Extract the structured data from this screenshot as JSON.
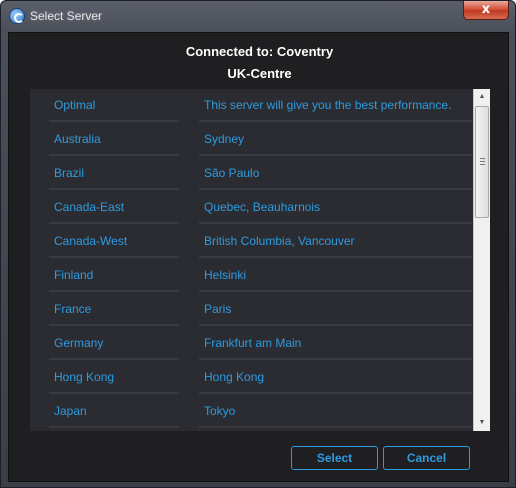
{
  "window": {
    "title": "Select Server",
    "close_label": "x"
  },
  "header": {
    "connected_label": "Connected to:",
    "connected_value": "Coventry",
    "region": "UK-Centre"
  },
  "servers": [
    {
      "region": "Optimal",
      "city": "This server will give you the best performance."
    },
    {
      "region": "Australia",
      "city": "Sydney"
    },
    {
      "region": "Brazil",
      "city": "São Paulo"
    },
    {
      "region": "Canada-East",
      "city": "Quebec, Beauharnois"
    },
    {
      "region": "Canada-West",
      "city": "British Columbia, Vancouver"
    },
    {
      "region": "Finland",
      "city": "Helsinki"
    },
    {
      "region": "France",
      "city": "Paris"
    },
    {
      "region": "Germany",
      "city": "Frankfurt am Main"
    },
    {
      "region": "Hong Kong",
      "city": "Hong Kong"
    },
    {
      "region": "Japan",
      "city": "Tokyo"
    }
  ],
  "buttons": {
    "select": "Select",
    "cancel": "Cancel"
  },
  "colors": {
    "accent": "#2d9be0",
    "panel": "#2b2c31",
    "background": "#1f1f22"
  }
}
